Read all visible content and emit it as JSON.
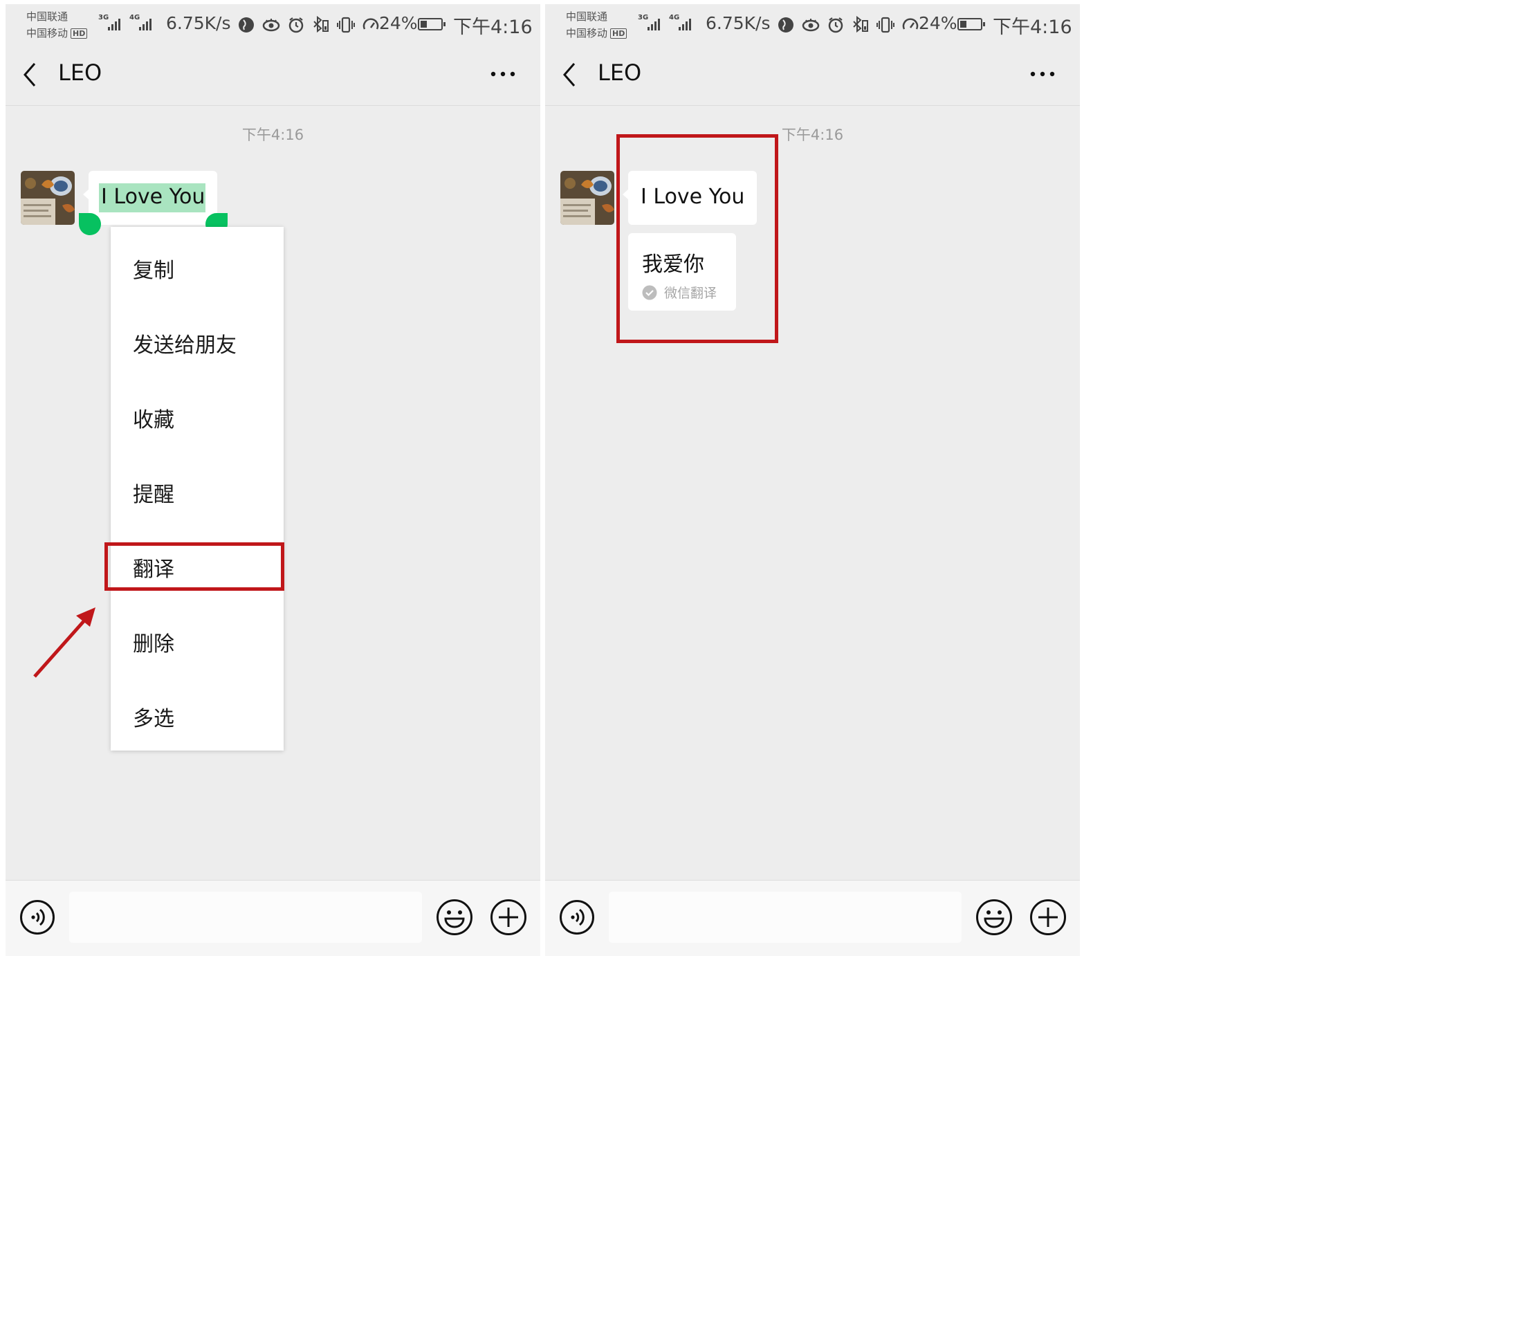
{
  "status_bar": {
    "carrier_1": "中国联通",
    "carrier_2": "中国移动",
    "hd_badge": "HD",
    "net_1": "3G",
    "net_2": "4G",
    "speed": "6.75K/s",
    "battery_percent": "24%",
    "time": "下午4:16"
  },
  "header": {
    "contact_name": "LEO"
  },
  "chat": {
    "timestamp": "下午4:16",
    "message": "I Love You",
    "translation": "我爱你",
    "translation_source": "微信翻译"
  },
  "context_menu": {
    "items": [
      "复制",
      "发送给朋友",
      "收藏",
      "提醒",
      "翻译",
      "删除",
      "多选"
    ],
    "highlighted_item": "翻译"
  },
  "icons": {
    "back": "chevron-left-icon",
    "more": "more-dots-icon",
    "voice": "voice-input-icon",
    "emoji": "emoji-icon",
    "plus": "plus-icon",
    "check": "check-circle-icon"
  },
  "colors": {
    "selection_green": "#07c160",
    "selection_fill": "#a9e4c0",
    "annotation_red": "#c0171a",
    "chat_bg": "#ededed"
  }
}
